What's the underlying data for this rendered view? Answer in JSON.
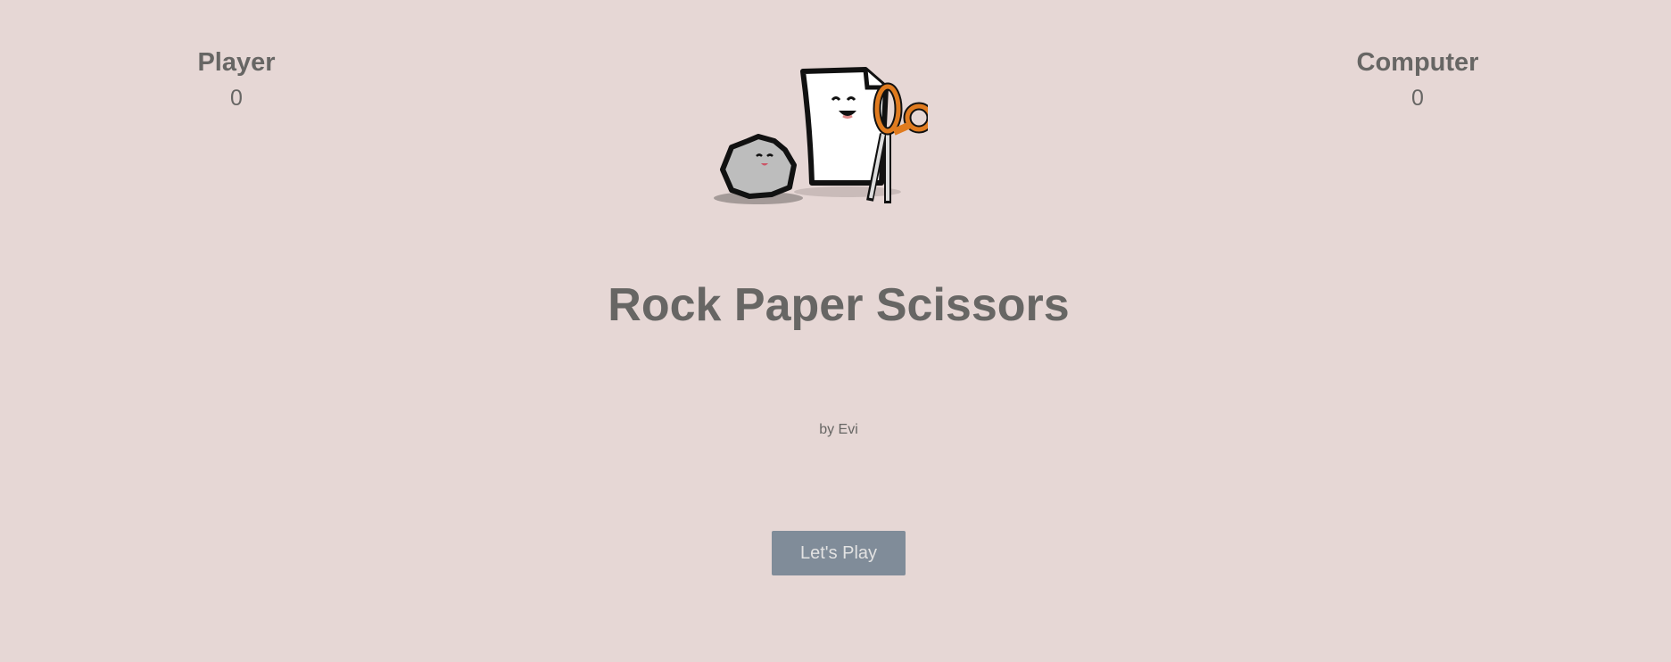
{
  "scoreboard": {
    "player": {
      "label": "Player",
      "score": "0"
    },
    "computer": {
      "label": "Computer",
      "score": "0"
    }
  },
  "title": "Rock Paper Scissors",
  "byline": "by Evi",
  "play_button": "Let's Play",
  "colors": {
    "background": "#e6d7d5",
    "text": "#676664",
    "button": "#808c99",
    "accent": "#e07b1f"
  }
}
